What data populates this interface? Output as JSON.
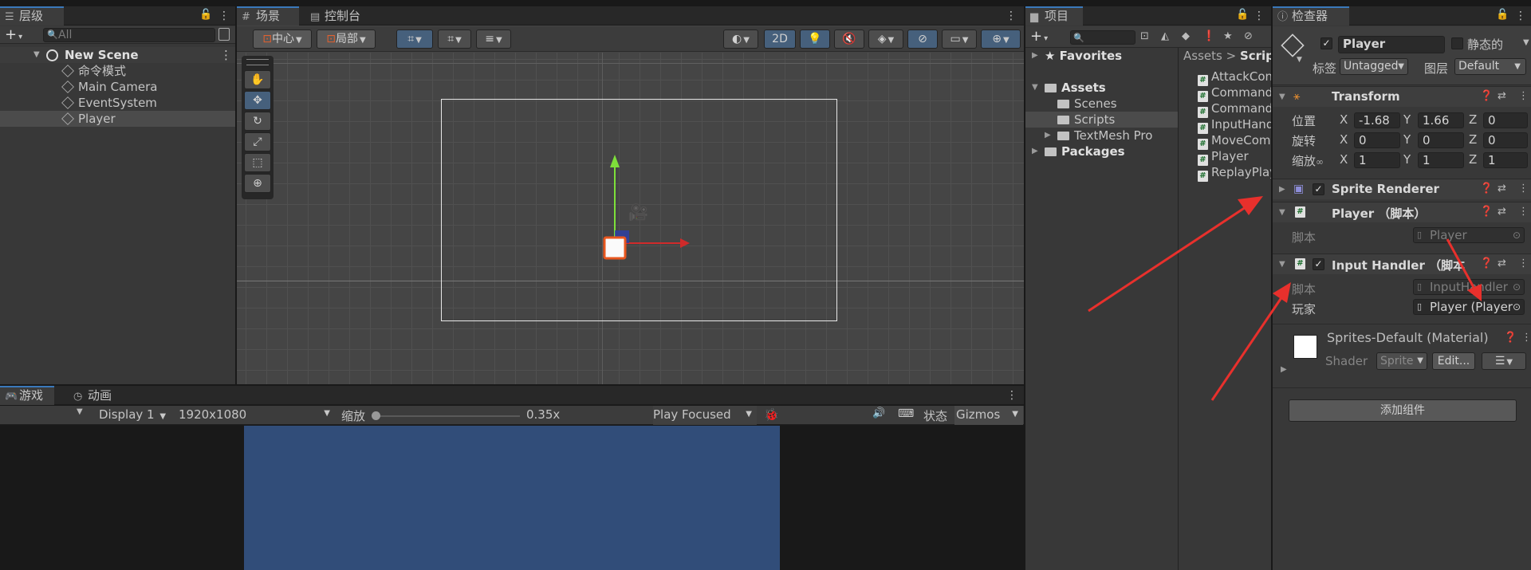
{
  "hierarchy": {
    "tab": "层级",
    "search_placeholder": "All",
    "scene": "New Scene",
    "items": [
      "命令模式",
      "Main Camera",
      "EventSystem",
      "Player"
    ]
  },
  "scene_view": {
    "tabs": [
      "场景",
      "控制台"
    ],
    "pivot": "中心",
    "space": "局部",
    "mode_2d": "2D"
  },
  "game_view": {
    "tabs": [
      "游戏",
      "动画"
    ],
    "display": "Display 1",
    "resolution": "1920x1080",
    "scale_label": "缩放",
    "scale_value": "0.35x",
    "play_mode": "Play Focused",
    "stats": "状态",
    "gizmos": "Gizmos"
  },
  "project": {
    "tab": "项目",
    "tree": {
      "favorites": "Favorites",
      "assets": "Assets",
      "scenes": "Scenes",
      "scripts": "Scripts",
      "textmesh": "TextMesh Pro",
      "packages": "Packages"
    },
    "breadcrumb": [
      "Assets",
      "Scrip"
    ],
    "files": [
      "AttackCon",
      "Command",
      "Command",
      "InputHand",
      "MoveCom",
      "Player",
      "ReplayPlay"
    ]
  },
  "inspector": {
    "tab": "检查器",
    "object_name": "Player",
    "static_label": "静态的",
    "tag_label": "标签",
    "tag_value": "Untagged",
    "layer_label": "图层",
    "layer_value": "Default",
    "transform": {
      "title": "Transform",
      "position_label": "位置",
      "rotation_label": "旋转",
      "scale_label": "缩放",
      "axes": [
        "X",
        "Y",
        "Z"
      ],
      "position": [
        "-1.68",
        "1.66",
        "0"
      ],
      "rotation": [
        "0",
        "0",
        "0"
      ],
      "scale": [
        "1",
        "1",
        "1"
      ]
    },
    "sprite_renderer": "Sprite Renderer",
    "player_script": {
      "title": "Player （脚本）",
      "script_label": "脚本",
      "script_value": "Player"
    },
    "input_handler": {
      "title": "Input Handler （脚本",
      "script_label": "脚本",
      "script_value": "InputHandler",
      "player_label": "玩家",
      "player_value": "Player (Player"
    },
    "material": {
      "name": "Sprites-Default (Material)",
      "shader_label": "Shader",
      "shader_value": "Sprite",
      "edit_button": "Edit..."
    },
    "add_component": "添加组件"
  },
  "colors": {
    "accent": "#3a79bb",
    "arrow": "#e8302c",
    "game_bg": "#314d79",
    "scene_bg": "#444444"
  }
}
